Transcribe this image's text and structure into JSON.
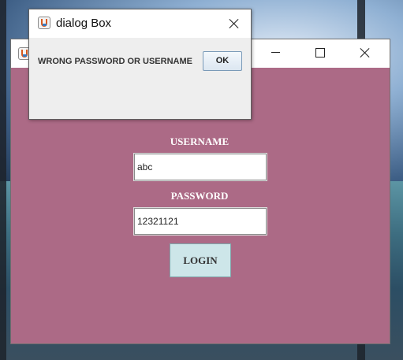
{
  "main_window": {
    "title": "",
    "controls": {
      "minimize": "minimize-icon",
      "maximize": "maximize-icon",
      "close": "close-icon"
    },
    "background_color": "#ac6a86",
    "form": {
      "username_label": "USERNAME",
      "username_value": "abc",
      "password_label": "PASSWORD",
      "password_value": "12321121",
      "login_button": "LOGIN"
    }
  },
  "dialog": {
    "title": "dialog Box",
    "message": "WRONG PASSWORD OR USERNAME",
    "ok_button": "OK",
    "close_icon": "close-icon"
  },
  "colors": {
    "accent": "#ac6a86",
    "button_bg": "#cde6e9"
  }
}
